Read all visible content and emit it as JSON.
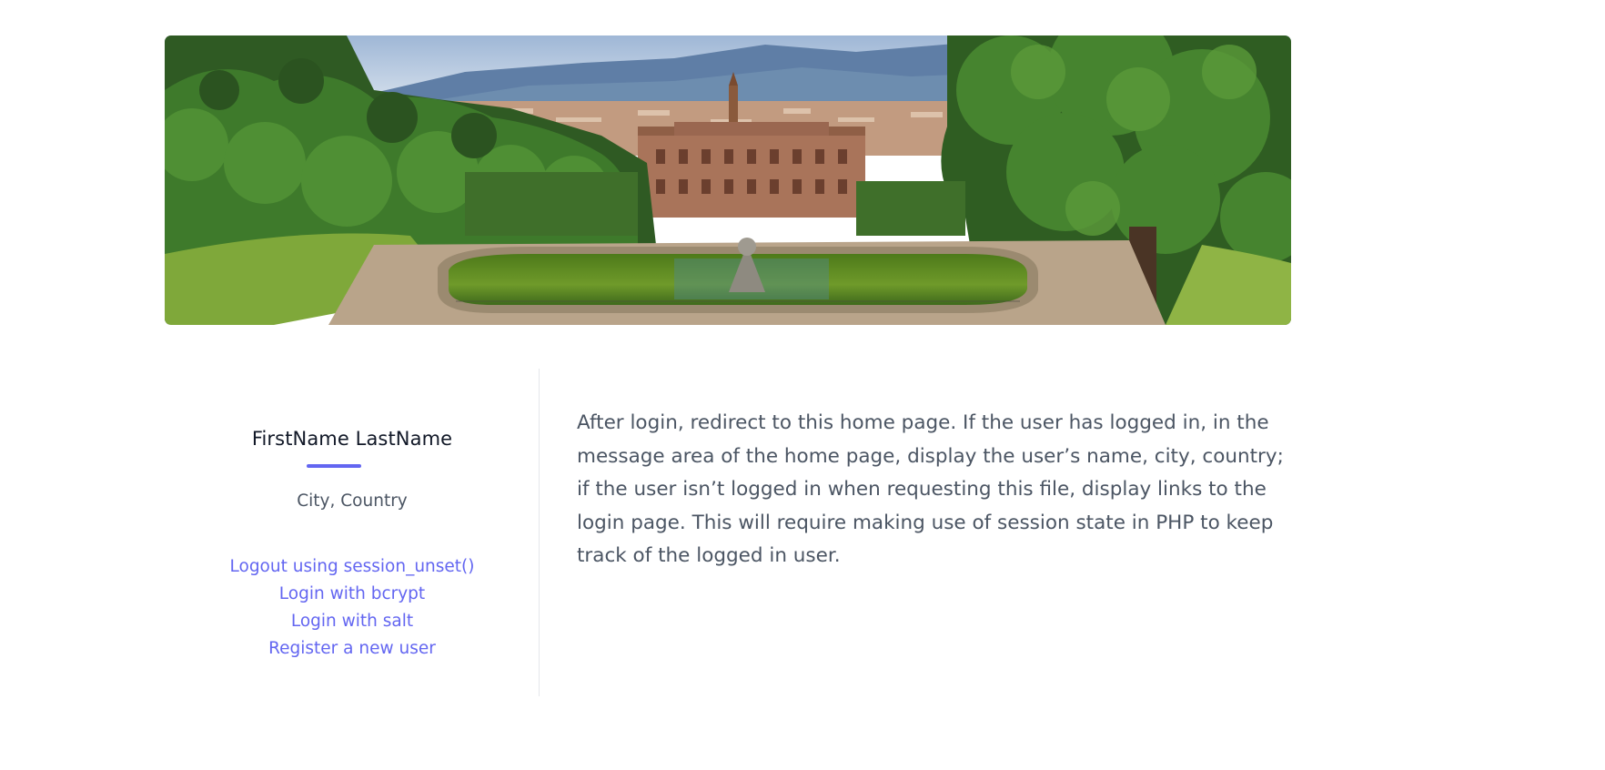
{
  "hero": {
    "image_alt": "Garden with fountain pond in front of a palace and city skyline with hills"
  },
  "profile": {
    "name": "FirstName LastName",
    "location": "City, Country",
    "links": [
      {
        "label": "Logout using session_unset()"
      },
      {
        "label": "Login with bcrypt"
      },
      {
        "label": "Login with salt"
      },
      {
        "label": "Register a new user"
      }
    ]
  },
  "message": {
    "text": "After login, redirect to this home page. If the user has logged in, in the message area of the home page, display the user’s name, city, country; if the user isn’t logged in when requesting this file, display links to the login page. This will require making use of session state in PHP to keep track of the logged in user."
  },
  "colors": {
    "accent": "#6366f1",
    "text": "#4b5563",
    "heading": "#111827",
    "divider": "#e5e7eb"
  }
}
